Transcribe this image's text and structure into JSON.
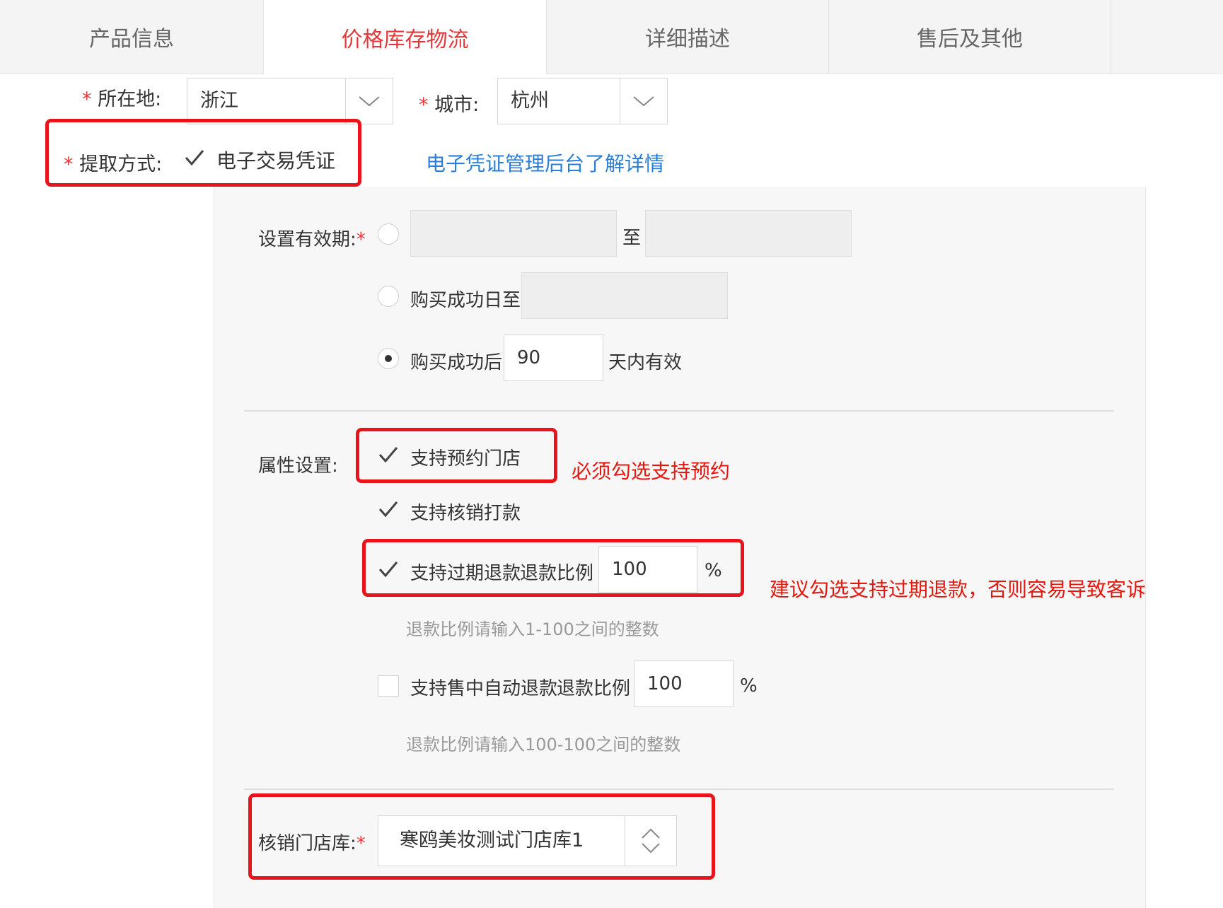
{
  "tabs": [
    {
      "label": "产品信息"
    },
    {
      "label": "价格库存物流"
    },
    {
      "label": "详细描述"
    },
    {
      "label": "售后及其他"
    }
  ],
  "location": {
    "required_mark": "*",
    "label": "所在地:",
    "value": "浙江"
  },
  "city": {
    "required_mark": "*",
    "label": "城市:",
    "value": "杭州"
  },
  "pickup": {
    "required_mark": "*",
    "label": "提取方式:",
    "option": "电子交易凭证",
    "checked": true
  },
  "links": {
    "admin": "电子凭证管理后台",
    "details": "了解详情"
  },
  "validity": {
    "label": "设置有效期:",
    "required_mark": "*",
    "range_separator": "至",
    "option_until": "购买成功日至",
    "option_after_prefix": "购买成功后",
    "days_value": "90",
    "option_after_suffix": "天内有效",
    "selected": "after"
  },
  "attributes": {
    "label": "属性设置:",
    "reserve_store": {
      "label": "支持预约门店",
      "checked": true
    },
    "verify_payment": {
      "label": "支持核销打款",
      "checked": true
    },
    "expired_refund": {
      "label": "支持过期退款",
      "ratio_label": "退款比例",
      "value": "100",
      "unit": "%",
      "checked": true,
      "hint": "退款比例请输入1-100之间的整数"
    },
    "auto_refund": {
      "label": "支持售中自动退款",
      "ratio_label": "退款比例",
      "value": "100",
      "unit": "%",
      "checked": false,
      "hint": "退款比例请输入100-100之间的整数"
    }
  },
  "store_library": {
    "label": "核销门店库:",
    "required_mark": "*",
    "value": "寒鸥美妆测试门店库1"
  },
  "annotations": {
    "reserve": "必须勾选支持预约",
    "refund": "建议勾选支持过期退款，否则容易导致客诉"
  }
}
